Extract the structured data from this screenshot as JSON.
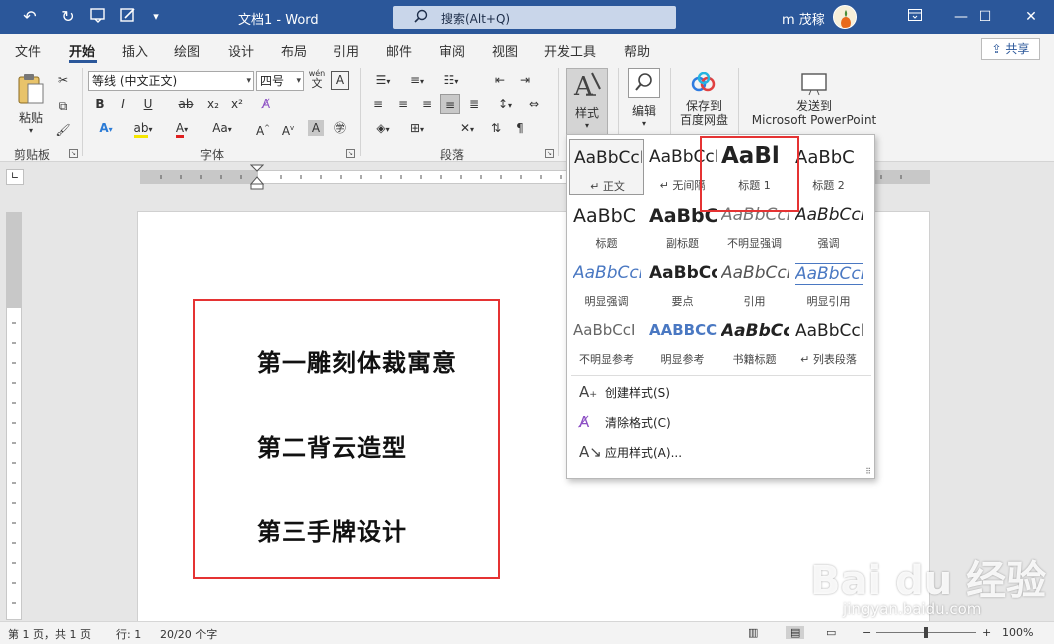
{
  "titlebar": {
    "doc_title": "文档1  -  Word",
    "search_text": "搜索(Alt+Q)",
    "user_name": "m 茂稼",
    "minimize": "—",
    "maximize": "☐",
    "close": "✕",
    "qat_undo": "↶",
    "qat_redo": "↻",
    "qat_more": "▾",
    "bg_color": "#2b579a"
  },
  "menu": {
    "tabs": [
      "文件",
      "开始",
      "插入",
      "绘图",
      "设计",
      "布局",
      "引用",
      "邮件",
      "审阅",
      "视图",
      "开发工具",
      "帮助"
    ],
    "active_tab": "开始",
    "share": "共享"
  },
  "ribbon": {
    "clipboard": {
      "paste": "粘贴",
      "label": "剪贴板"
    },
    "font": {
      "family": "等线 (中文正文)",
      "size": "四号",
      "wen": "wén",
      "label": "字体",
      "bold": "B",
      "italic": "I",
      "underline": "U",
      "strike": "ab",
      "sub": "x₂",
      "sup": "x²",
      "aa_case": "Aa",
      "grow": "A",
      "shrink": "A"
    },
    "paragraph": {
      "label": "段落"
    },
    "styles": {
      "label": "样式"
    },
    "edit": {
      "label": "编辑"
    },
    "baidu": {
      "label1": "保存到",
      "label2": "百度网盘"
    },
    "ppt": {
      "label1": "发送到",
      "label2": "Microsoft PowerPoint"
    }
  },
  "gallery": {
    "styles": [
      {
        "sample": "AaBbCcI",
        "name": "↵ 正文"
      },
      {
        "sample": "AaBbCcI",
        "name": "↵ 无间隔"
      },
      {
        "sample": "AaBl",
        "name": "标题 1"
      },
      {
        "sample": "AaBbC",
        "name": "标题 2"
      },
      {
        "sample": "AaBbC",
        "name": "标题"
      },
      {
        "sample": "AaBbC",
        "name": "副标题"
      },
      {
        "sample": "AaBbCcI",
        "name": "不明显强调"
      },
      {
        "sample": "AaBbCcI",
        "name": "强调"
      },
      {
        "sample": "AaBbCcI",
        "name": "明显强调"
      },
      {
        "sample": "AaBbCcI",
        "name": "要点"
      },
      {
        "sample": "AaBbCcI",
        "name": "引用"
      },
      {
        "sample": "AaBbCcI",
        "name": "明显引用"
      },
      {
        "sample": "AaBbCcI",
        "name": "不明显参考"
      },
      {
        "sample": "AABBCCI",
        "name": "明显参考"
      },
      {
        "sample": "AaBbCcI",
        "name": "书籍标题"
      },
      {
        "sample": "AaBbCcI",
        "name": "↵ 列表段落"
      }
    ],
    "commands": [
      {
        "icon": "A₊",
        "label": "创建样式(S)"
      },
      {
        "icon": "A̸",
        "label": "清除格式(C)"
      },
      {
        "icon": "A↘",
        "label": "应用样式(A)..."
      }
    ]
  },
  "document": {
    "lines": [
      "第一雕刻体裁寓意",
      "第二背云造型",
      "第三手牌设计"
    ],
    "highlight_color": "#e53333"
  },
  "status": {
    "page": "第 1 页，共 1 页",
    "line": "行: 1",
    "words": "20/20 个字",
    "zoom": "100%",
    "minus": "−",
    "plus": "+"
  },
  "watermark": {
    "text": "Bai du 经验",
    "url": "jingyan.baidu.com"
  }
}
